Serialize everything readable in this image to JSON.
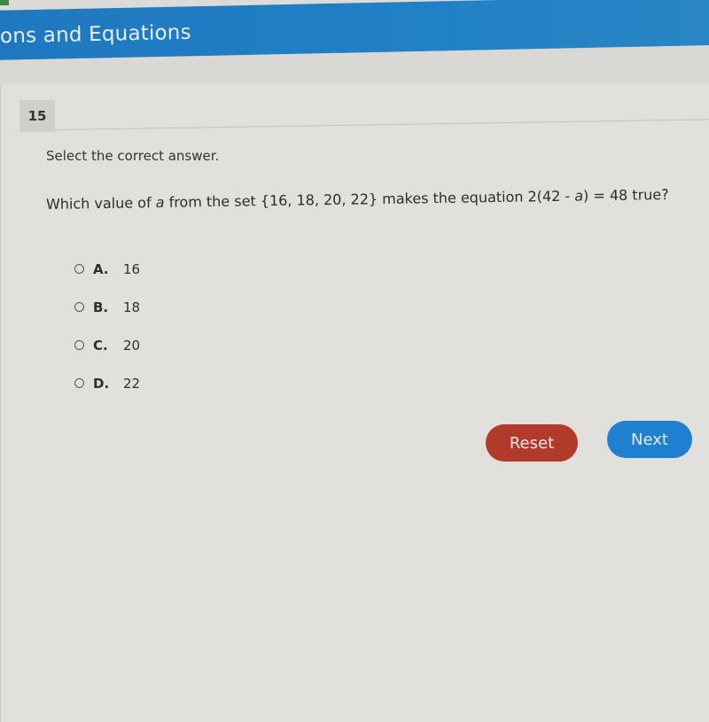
{
  "header": {
    "title": "ons and Equations"
  },
  "question": {
    "number": "15",
    "instruction": "Select the correct answer.",
    "text_before": "Which value of ",
    "variable": "a",
    "text_after": " from the set {16, 18, 20, 22} makes the equation 2(42 - ",
    "variable2": "a",
    "text_end": ") = 48 true?"
  },
  "options": [
    {
      "letter": "A.",
      "value": "16"
    },
    {
      "letter": "B.",
      "value": "18"
    },
    {
      "letter": "C.",
      "value": "20"
    },
    {
      "letter": "D.",
      "value": "22"
    }
  ],
  "buttons": {
    "reset": "Reset",
    "next": "Next"
  },
  "colors": {
    "banner": "#1f78bf",
    "reset": "#b23a2a",
    "next": "#1f7fd0"
  }
}
